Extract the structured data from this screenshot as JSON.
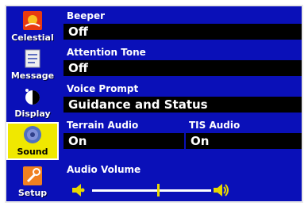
{
  "sidebar": {
    "items": [
      {
        "label": "Celestial",
        "icon": "celestial-icon"
      },
      {
        "label": "Message",
        "icon": "message-icon"
      },
      {
        "label": "Display",
        "icon": "display-icon"
      },
      {
        "label": "Sound",
        "icon": "speaker-icon",
        "selected": true
      },
      {
        "label": "Setup",
        "icon": "setup-icon"
      }
    ]
  },
  "sound": {
    "beeper": {
      "label": "Beeper",
      "value": "Off"
    },
    "attention_tone": {
      "label": "Attention Tone",
      "value": "Off"
    },
    "voice_prompt": {
      "label": "Voice Prompt",
      "value": "Guidance and Status"
    },
    "terrain_audio": {
      "label": "Terrain Audio",
      "value": "On"
    },
    "tis_audio": {
      "label": "TIS Audio",
      "value": "On"
    },
    "audio_volume": {
      "label": "Audio Volume",
      "level": 0.55
    }
  },
  "colors": {
    "background": "#0a10b8",
    "selected_tab": "#f0e800",
    "field": "#000000",
    "slider_thumb": "#e8d800"
  }
}
